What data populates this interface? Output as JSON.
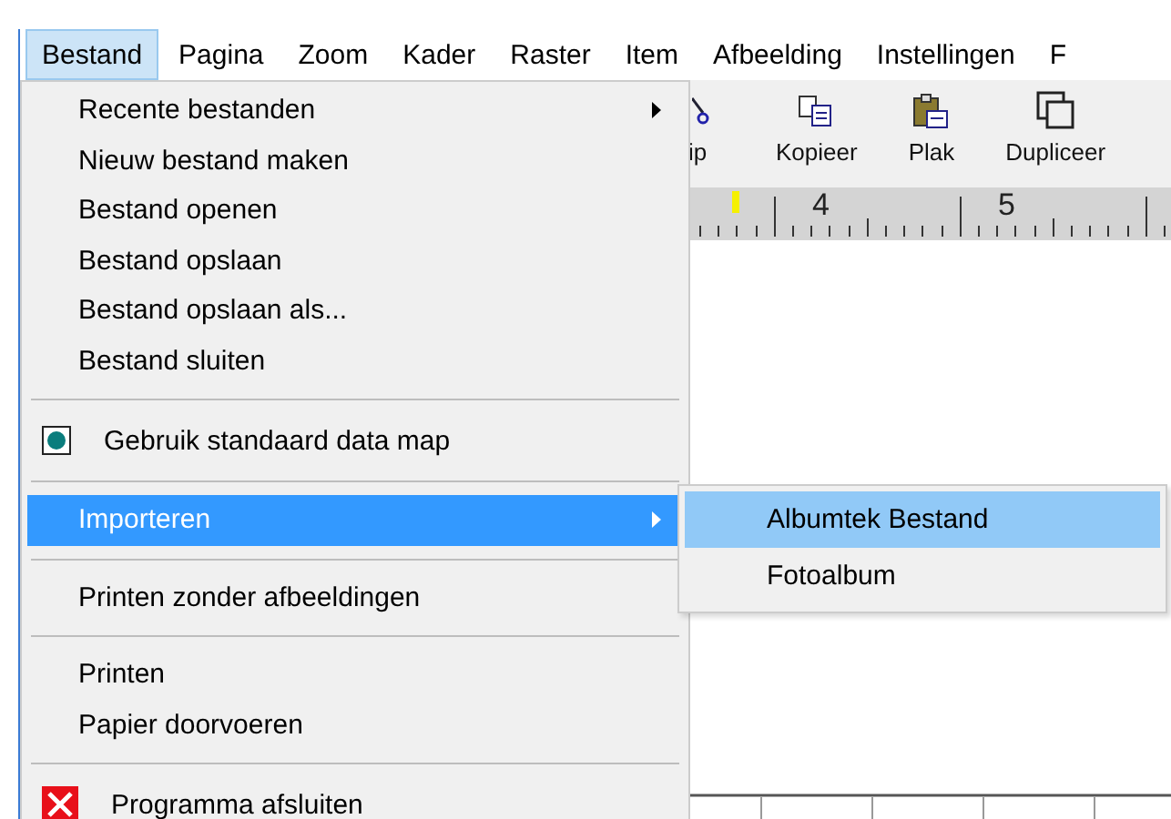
{
  "menu_bar": [
    {
      "label": "Bestand",
      "selected": true
    },
    {
      "label": "Pagina",
      "selected": false
    },
    {
      "label": "Zoom",
      "selected": false
    },
    {
      "label": "Kader",
      "selected": false
    },
    {
      "label": "Raster",
      "selected": false
    },
    {
      "label": "Item",
      "selected": false
    },
    {
      "label": "Afbeelding",
      "selected": false
    },
    {
      "label": "Instellingen",
      "selected": false
    },
    {
      "label": "F",
      "selected": false
    }
  ],
  "toolbar": [
    {
      "label": "ip",
      "kind": "cut"
    },
    {
      "label": "Kopieer",
      "kind": "copy"
    },
    {
      "label": "Plak",
      "kind": "paste"
    },
    {
      "label": "Dupliceer",
      "kind": "duplicate"
    }
  ],
  "ruler": {
    "labels": [
      "4",
      "5"
    ]
  },
  "file_menu": [
    {
      "kind": "item",
      "label": "Recente bestanden",
      "submenu": true,
      "selected": false
    },
    {
      "kind": "item",
      "label": "Nieuw bestand maken",
      "submenu": false,
      "selected": false
    },
    {
      "kind": "item",
      "label": "Bestand openen",
      "submenu": false,
      "selected": false
    },
    {
      "kind": "item",
      "label": "Bestand opslaan",
      "submenu": false,
      "selected": false
    },
    {
      "kind": "item",
      "label": "Bestand opslaan als...",
      "submenu": false,
      "selected": false
    },
    {
      "kind": "item",
      "label": "Bestand sluiten",
      "submenu": false,
      "selected": false
    },
    {
      "kind": "separator"
    },
    {
      "kind": "check",
      "label": "Gebruik standaard data map",
      "checked": true,
      "selected": false
    },
    {
      "kind": "separator"
    },
    {
      "kind": "item",
      "label": "Importeren",
      "submenu": true,
      "selected": true
    },
    {
      "kind": "separator"
    },
    {
      "kind": "item",
      "label": "Printen zonder afbeeldingen",
      "submenu": false,
      "selected": false
    },
    {
      "kind": "separator"
    },
    {
      "kind": "item",
      "label": "Printen",
      "submenu": false,
      "selected": false
    },
    {
      "kind": "item",
      "label": "Papier doorvoeren",
      "submenu": false,
      "selected": false
    },
    {
      "kind": "separator"
    },
    {
      "kind": "exit",
      "label": "Programma afsluiten",
      "selected": false
    }
  ],
  "import_submenu": [
    {
      "label": "Albumtek Bestand",
      "selected": true
    },
    {
      "label": "Fotoalbum",
      "selected": false
    }
  ]
}
